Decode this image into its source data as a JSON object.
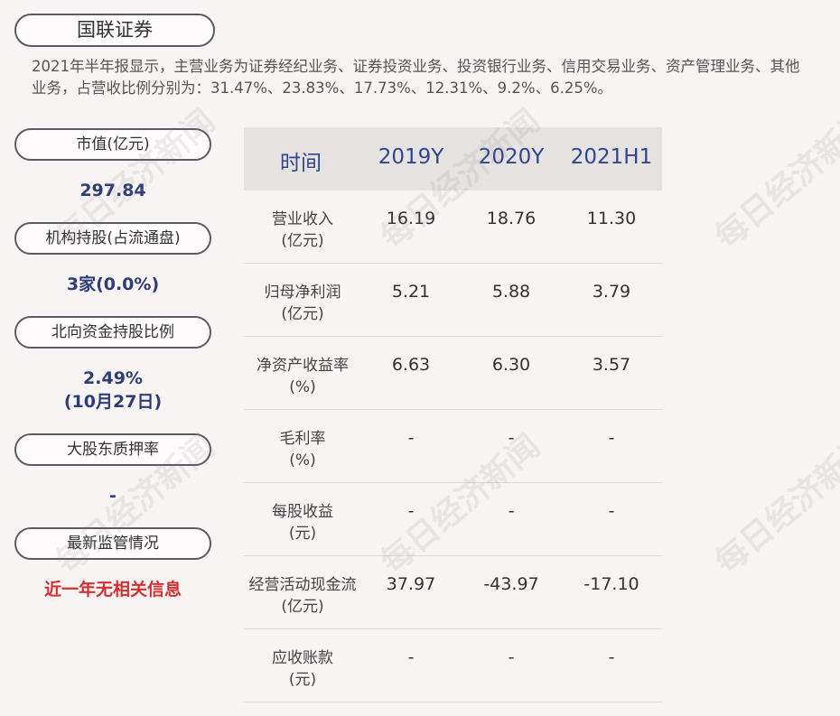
{
  "company": "国联证券",
  "summary": "2021年半年报显示，主营业务为证券经纪业务、证券投资业务、投资银行业务、信用交易业务、资产管理业务、其他业务，占营收比例分别为：31.47%、23.83%、17.73%、12.31%、9.2%、6.25%。",
  "sidebar": {
    "market_cap_label": "市值(亿元)",
    "market_cap_value": "297.84",
    "inst_label": "机构持股(占流通盘)",
    "inst_value": "3家(0.0%)",
    "north_label": "北向资金持股比例",
    "north_value": "2.49%",
    "north_date": "(10月27日)",
    "pledge_label": "大股东质押率",
    "pledge_value": "-",
    "reg_label": "最新监管情况",
    "reg_value": "近一年无相关信息"
  },
  "table": {
    "headers": [
      "时间",
      "2019Y",
      "2020Y",
      "2021H1"
    ],
    "rows": [
      {
        "label1": "营业收入",
        "label2": "(亿元)",
        "v": [
          "16.19",
          "18.76",
          "11.30"
        ]
      },
      {
        "label1": "归母净利润",
        "label2": "(亿元)",
        "v": [
          "5.21",
          "5.88",
          "3.79"
        ]
      },
      {
        "label1": "净资产收益率",
        "label2": "(%)",
        "v": [
          "6.63",
          "6.30",
          "3.57"
        ]
      },
      {
        "label1": "毛利率",
        "label2": "(%)",
        "v": [
          "-",
          "-",
          "-"
        ]
      },
      {
        "label1": "每股收益",
        "label2": "(元)",
        "v": [
          "-",
          "-",
          "-"
        ]
      },
      {
        "label1": "经营活动现金流",
        "label2": "(亿元)",
        "v": [
          "37.97",
          "-43.97",
          "-17.10"
        ]
      },
      {
        "label1": "应收账款",
        "label2": "(元)",
        "v": [
          "-",
          "-",
          "-"
        ]
      }
    ]
  },
  "watermark": "每日经济新闻"
}
